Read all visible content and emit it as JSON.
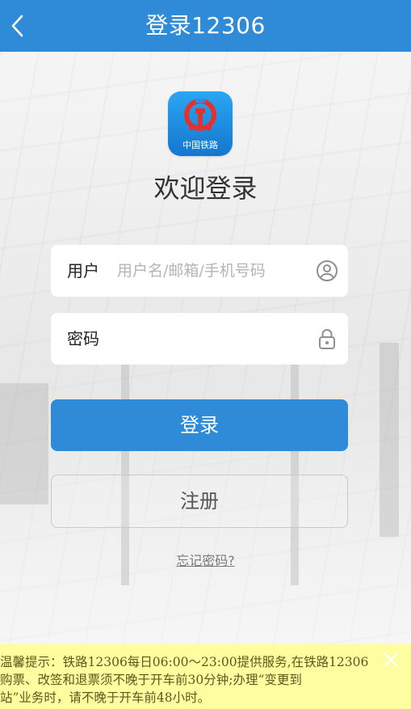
{
  "header": {
    "title": "登录12306",
    "back_icon": "chevron-left-icon"
  },
  "logo": {
    "caption": "中国铁路",
    "icon": "china-railway-logo"
  },
  "welcome": "欢迎登录",
  "username": {
    "label": "用户",
    "placeholder": "用户名/邮箱/手机号码",
    "value": "",
    "icon": "user-circle-icon"
  },
  "password": {
    "label": "密码",
    "placeholder": "",
    "value": "",
    "icon": "lock-icon"
  },
  "buttons": {
    "login": "登录",
    "register": "注册"
  },
  "forgot": "忘记密码?",
  "notice": {
    "line1": "温馨提示：铁路12306每日06:00～23:00提供服务,在铁路12306",
    "line2": "购票、改签和退票须不晚于开车前30分钟;办理“变更到",
    "line3": "站”业务时，请不晚于开车前48小时。",
    "close_icon": "close-icon"
  },
  "colors": {
    "primary": "#2f8bd8",
    "notice_bg": "#fefd9f",
    "notice_text": "#5b5a1d"
  }
}
